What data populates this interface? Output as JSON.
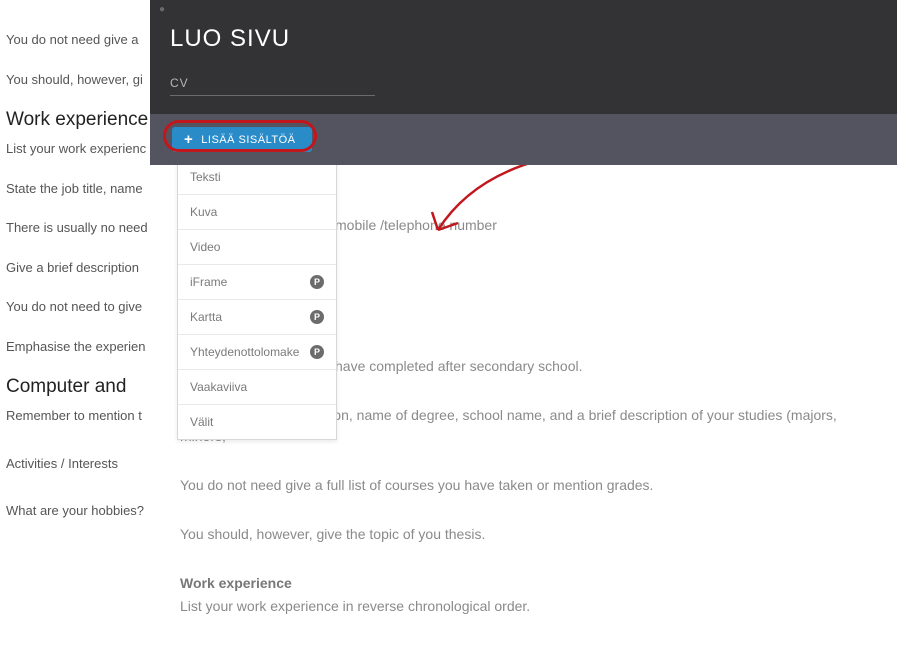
{
  "bg": {
    "l1": "You do not need give a",
    "l2": "You should, however, gi",
    "h1": "Work experience",
    "l3": "List your work experienc",
    "l4": "State the job title, name",
    "l5": "There is usually no need",
    "l6": "Give a brief description",
    "l7": "You do not need to give",
    "l8": "Emphasise the experien",
    "h2": "Computer and",
    "l9": "Remember to mention t",
    "l10": "Activities / Interests",
    "l11": "What are your hobbies?"
  },
  "modal": {
    "title": "LUO SIVU",
    "input_value": "CV",
    "add_label": "LISÄÄ SISÄLTÖÄ"
  },
  "dropdown": {
    "items": [
      {
        "label": "Teksti",
        "premium": false
      },
      {
        "label": "Kuva",
        "premium": false
      },
      {
        "label": "Video",
        "premium": false
      },
      {
        "label": "iFrame",
        "premium": true
      },
      {
        "label": "Kartta",
        "premium": true
      },
      {
        "label": "Yhteydenottolomake",
        "premium": true
      },
      {
        "label": "Vaakaviiva",
        "premium": false
      },
      {
        "label": "Välit",
        "premium": false
      }
    ],
    "premium_badge": "P"
  },
  "body": {
    "frag1": "mobile /telephone number",
    "frag2": "have completed after secondary school.",
    "p1": "Give the year of graduation, name of degree, school name, and a brief description of your studies (majors, minors,",
    "p2": "You do not need give a full list of courses you have taken or mention grades.",
    "p3": "You should, however, give the topic of you thesis.",
    "h_work": "Work experience",
    "p4": "List your work experience in reverse chronological order."
  }
}
